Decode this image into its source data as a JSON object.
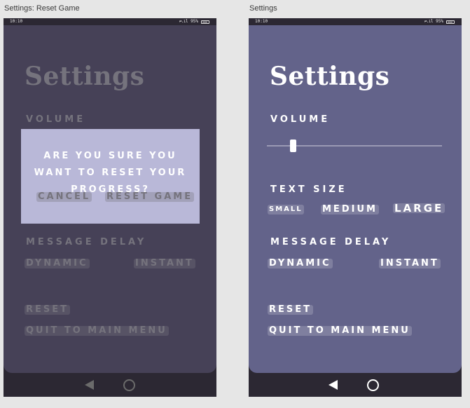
{
  "left_frame": {
    "frame_label": "Settings: Reset Game",
    "status_time": "10:10",
    "status_icons": "⇌.ıl",
    "battery": "95%",
    "title": "Settings",
    "volume_label": "VOLUME",
    "dialog": {
      "message": "ARE YOU SURE YOU WANT TO RESET YOUR PROGRESS?",
      "cancel_label": "CANCEL",
      "confirm_label": "RESET GAME"
    },
    "message_delay_label": "MESSAGE DELAY",
    "dynamic_label": "DYNAMIC",
    "instant_label": "INSTANT",
    "reset_label": "RESET",
    "quit_label": "QUIT TO MAIN MENU"
  },
  "right_frame": {
    "frame_label": "Settings",
    "status_time": "10:10",
    "status_icons": "⇌.ıl",
    "battery": "95%",
    "title": "Settings",
    "volume_label": "VOLUME",
    "volume_value": 0.15,
    "text_size_label": "TEXT SIZE",
    "text_size_options": [
      "SMALL",
      "MEDIUM",
      "LARGE"
    ],
    "message_delay_label": "MESSAGE DELAY",
    "dynamic_label": "DYNAMIC",
    "instant_label": "INSTANT",
    "reset_label": "RESET",
    "quit_label": "QUIT TO MAIN MENU"
  },
  "colors": {
    "canvas_bg": "#e6e6e6",
    "left_screen_bg": "#464157",
    "right_screen_bg": "#63638a",
    "dialog_bg": "#b9b8d8",
    "nav_bar": "#2c2833"
  },
  "icons": [
    "back-triangle-icon",
    "home-circle-icon",
    "battery-icon",
    "signal-icon"
  ]
}
